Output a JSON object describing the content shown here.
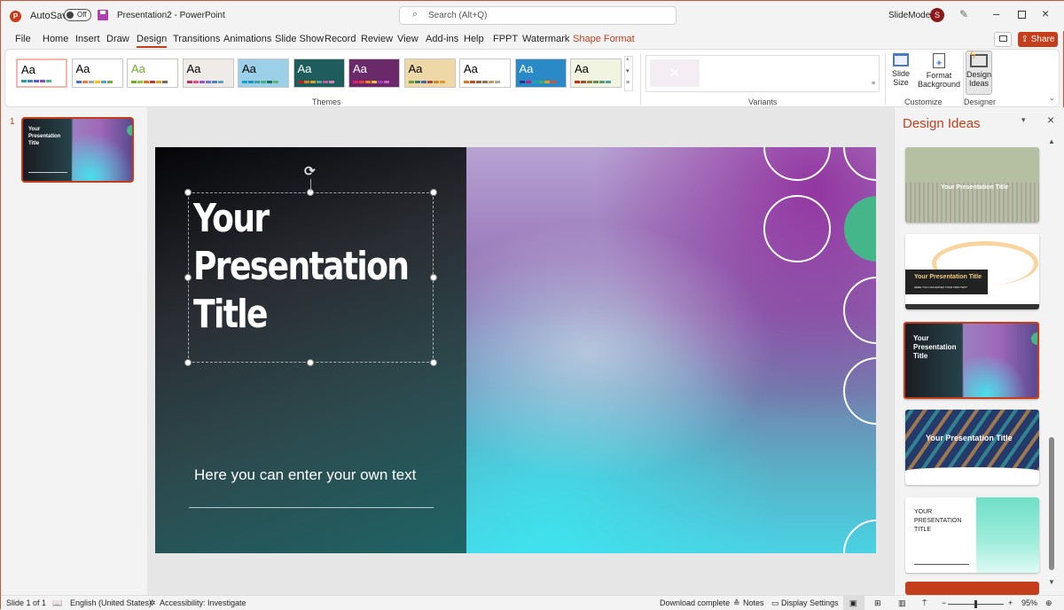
{
  "titlebar": {
    "autosave_label": "AutoSave",
    "autosave_state": "Off",
    "document_title": "Presentation2  -  PowerPoint",
    "search_placeholder": "Search (Alt+Q)",
    "account_name": "SlideModel",
    "avatar_initial": "S"
  },
  "menu": {
    "tabs": [
      "File",
      "Home",
      "Insert",
      "Draw",
      "Design",
      "Transitions",
      "Animations",
      "Slide Show",
      "Record",
      "Review",
      "View",
      "Add-ins",
      "Help",
      "FPPT",
      "Watermark",
      "Shape Format"
    ],
    "active_tab": "Design",
    "contextual_tab": "Shape Format",
    "share_label": "Share"
  },
  "ribbon": {
    "themes_group_label": "Themes",
    "variants_group_label": "Variants",
    "customize_group_label": "Customize",
    "designer_group_label": "Designer",
    "slide_size_label": "Slide Size",
    "format_background_label": "Format Background",
    "design_ideas_label": "Design Ideas",
    "theme_sample_text": "Aa",
    "themes": [
      {
        "name": "theme-1",
        "bg": "#ffffff",
        "fg": "#000000",
        "colors": [
          "#2a9d8f",
          "#3a86c8",
          "#5a5ac8",
          "#8a4ac8",
          "#4ab890"
        ]
      },
      {
        "name": "theme-2",
        "bg": "#ffffff",
        "fg": "#000000",
        "colors": [
          "#4472c4",
          "#ed7d31",
          "#a5a5a5",
          "#ffc000",
          "#5b9bd5",
          "#70ad47"
        ]
      },
      {
        "name": "theme-3",
        "bg": "#ffffff",
        "fg": "#6ab023",
        "colors": [
          "#6ab023",
          "#8cc63f",
          "#e07020",
          "#c0392b",
          "#e0a030",
          "#7a6a5a"
        ]
      },
      {
        "name": "theme-4",
        "bg": "#efebe7",
        "fg": "#000000",
        "colors": [
          "#c0306a",
          "#e05090",
          "#a050c0",
          "#7070d0",
          "#5080c0",
          "#60a0c0"
        ]
      },
      {
        "name": "theme-5",
        "bg": "#9bd0e8",
        "fg": "#000000",
        "colors": [
          "#1ca0d0",
          "#2090c0",
          "#40a0a0",
          "#40b080",
          "#207060",
          "#60b070"
        ]
      },
      {
        "name": "theme-6",
        "bg": "#1f5c5c",
        "fg": "#ffffff",
        "colors": [
          "#c02020",
          "#e08020",
          "#d0a030",
          "#60a0a0",
          "#c060a0",
          "#d080c0"
        ]
      },
      {
        "name": "theme-7",
        "bg": "#6a2a6a",
        "fg": "#ffffff",
        "colors": [
          "#e0206a",
          "#e04040",
          "#f08030",
          "#f0c030",
          "#a040c0",
          "#d060d0"
        ]
      },
      {
        "name": "theme-8",
        "bg": "#eed8a8",
        "fg": "#000000",
        "colors": [
          "#6a9a3a",
          "#3a7a6a",
          "#3a6aaa",
          "#aa4a3a",
          "#ca8a2a",
          "#da9a3a"
        ]
      },
      {
        "name": "theme-9",
        "bg": "#ffffff",
        "fg": "#000000",
        "colors": [
          "#e07020",
          "#c05020",
          "#a06040",
          "#907060",
          "#c0a060",
          "#a0b090"
        ]
      },
      {
        "name": "theme-10",
        "bg": "#2a8ac8",
        "fg": "#ffffff",
        "colors": [
          "#1a3a8a",
          "#c02080",
          "#20a0b0",
          "#40b060",
          "#e0a020",
          "#e05020"
        ]
      },
      {
        "name": "theme-11",
        "bg": "#f0f4e0",
        "fg": "#000000",
        "colors": [
          "#c03020",
          "#a05030",
          "#8a7a40",
          "#6a8a50",
          "#5a9a7a",
          "#4aa0a0"
        ]
      }
    ]
  },
  "thumbnails": {
    "slide_number": "1",
    "title": "Your Presentation Title"
  },
  "slide": {
    "title_lines": [
      "Your",
      "Presentation",
      "Title"
    ],
    "subtitle": "Here you can enter your own text"
  },
  "design_pane": {
    "title": "Design Ideas",
    "ideas": [
      {
        "name": "idea-grid-dots",
        "title": "Your Presentation Title"
      },
      {
        "name": "idea-orange-waves",
        "title": "Your Presentation Title",
        "subtitle": "HERE YOU CAN ENTER YOUR OWN TEXT"
      },
      {
        "name": "idea-watercolor-selected",
        "title": "Your Presentation Title"
      },
      {
        "name": "idea-navy-stripes",
        "title": "Your Presentation Title"
      },
      {
        "name": "idea-mint-split",
        "title": "YOUR PRESENTATION TITLE"
      }
    ]
  },
  "statusbar": {
    "slide_counter": "Slide 1 of 1",
    "language": "English (United States)",
    "accessibility": "Accessibility: Investigate",
    "download_status": "Download complete",
    "notes_label": "Notes",
    "display_settings_label": "Display Settings",
    "zoom_level": "95%"
  },
  "colors": {
    "accent": "#c43e1c",
    "ribbon_bg": "#ffffff",
    "app_bg": "#f3f3f3",
    "green_circle": "#45b58a"
  }
}
